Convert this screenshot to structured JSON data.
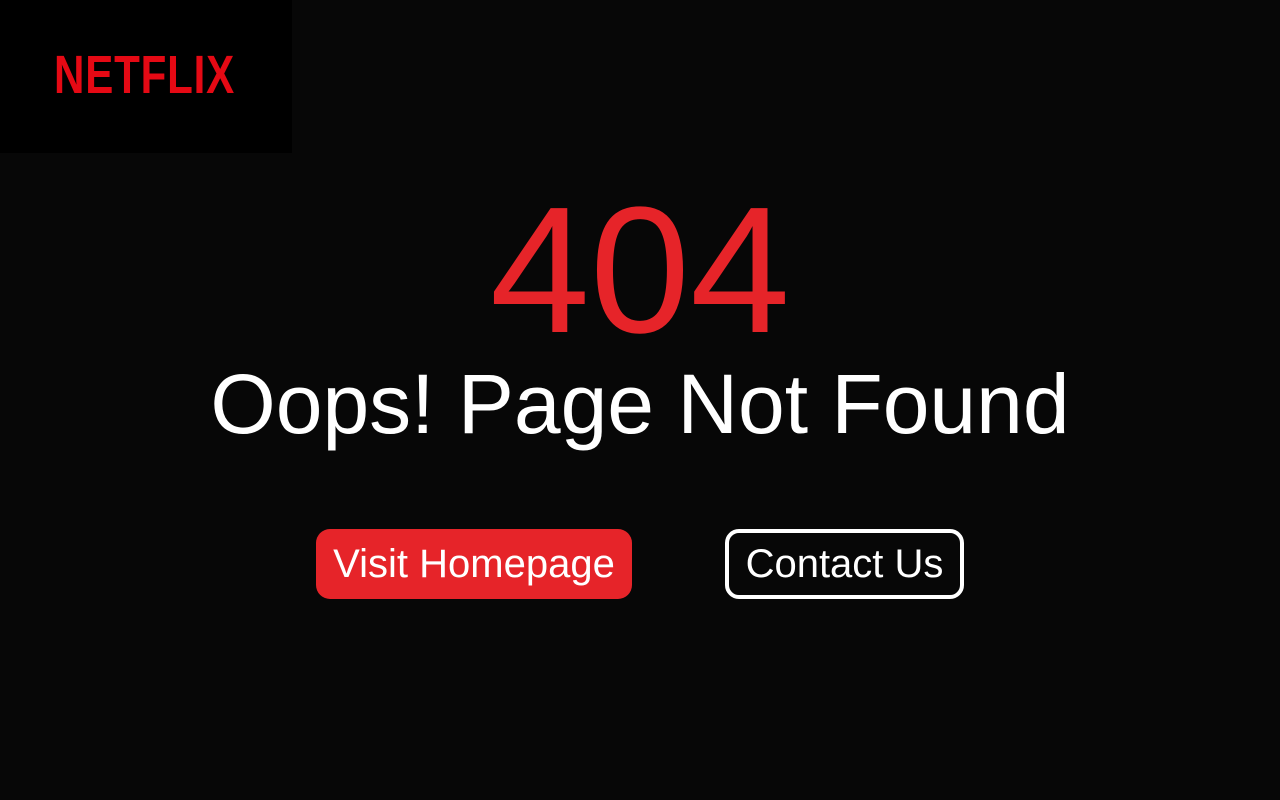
{
  "brand": {
    "logo_text": "NETFLIX",
    "accent_color": "#E50914",
    "red_color": "#E62429"
  },
  "error": {
    "code": "404",
    "message": "Oops! Page Not Found"
  },
  "actions": {
    "primary_label": "Visit Homepage",
    "secondary_label": "Contact Us"
  },
  "colors": {
    "background": "#070707",
    "logo_background": "#000000",
    "text": "#FFFFFF"
  }
}
